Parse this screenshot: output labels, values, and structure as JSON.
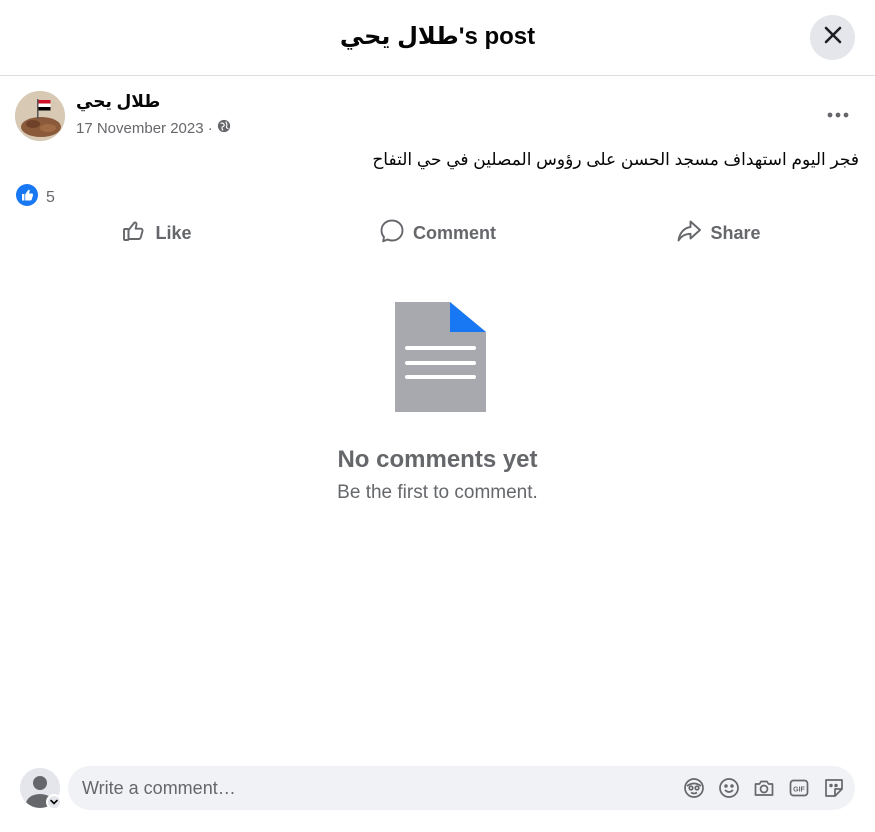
{
  "header": {
    "title": "طلال يحي's post",
    "close_icon": "close-icon"
  },
  "post": {
    "author": "طلال يحي",
    "date": "17 November 2023 ·",
    "privacy_icon": "globe-icon",
    "more_icon": "more-horizontal-icon",
    "text": "فجر اليوم استهداف مسجد الحسن على رؤوس المصلين في حي التفاح",
    "reaction_icon": "like-reaction-icon",
    "reaction_count": "5"
  },
  "actions": [
    {
      "label": "Like",
      "icon": "thumbs-up-icon"
    },
    {
      "label": "Comment",
      "icon": "comment-bubble-icon"
    },
    {
      "label": "Share",
      "icon": "share-arrow-icon"
    }
  ],
  "empty_state": {
    "icon": "document-icon",
    "title": "No comments yet",
    "subtitle": "Be the first to comment."
  },
  "composer": {
    "placeholder": "Write a comment…",
    "icons": [
      "avatar-sticker-icon",
      "emoji-icon",
      "camera-icon",
      "gif-icon",
      "sticker-icon"
    ]
  },
  "colors": {
    "accent": "#1877f2",
    "secondary_text": "#65676b",
    "surface": "#f0f2f5",
    "document_gray": "#a7a9ae"
  }
}
